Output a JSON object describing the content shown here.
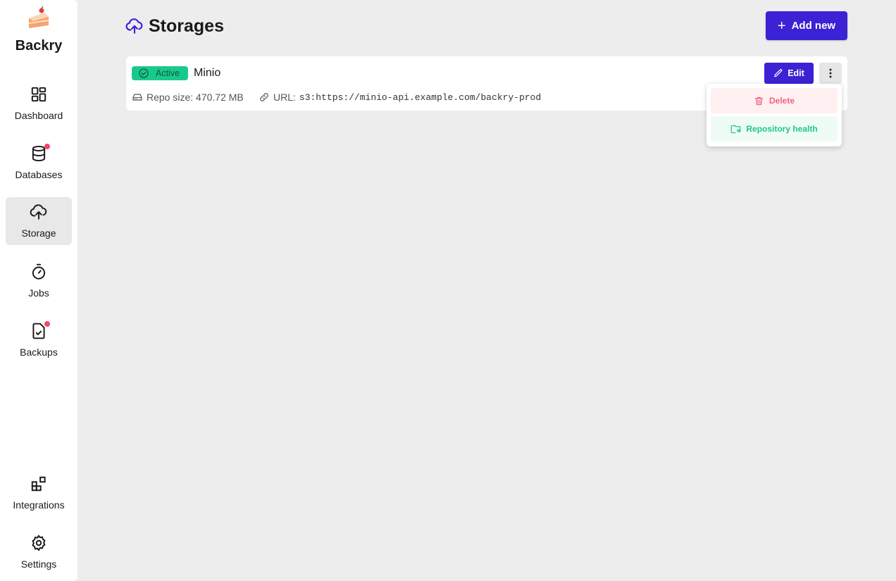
{
  "app": {
    "name": "Backry"
  },
  "sidebar": {
    "items": [
      {
        "label": "Dashboard",
        "icon": "dashboard-icon",
        "active": false,
        "notification": false
      },
      {
        "label": "Databases",
        "icon": "database-icon",
        "active": false,
        "notification": true
      },
      {
        "label": "Storage",
        "icon": "cloud-upload-icon",
        "active": true,
        "notification": false
      },
      {
        "label": "Jobs",
        "icon": "stopwatch-icon",
        "active": false,
        "notification": false
      },
      {
        "label": "Backups",
        "icon": "file-check-icon",
        "active": false,
        "notification": true
      }
    ],
    "bottom_items": [
      {
        "label": "Integrations",
        "icon": "integrations-icon"
      },
      {
        "label": "Settings",
        "icon": "gear-icon"
      }
    ]
  },
  "header": {
    "title": "Storages",
    "icon": "cloud-upload-icon"
  },
  "add_button": {
    "label": "Add new"
  },
  "storages": [
    {
      "status": "Active",
      "name": "Minio",
      "repo_size_label": "Repo size: 470.72 MB",
      "url_label": "URL:",
      "url": "s3:https://minio-api.example.com/backry-prod",
      "edit_label": "Edit"
    }
  ],
  "dropdown": {
    "delete_label": "Delete",
    "health_label": "Repository health"
  },
  "colors": {
    "accent": "#3b22d4",
    "active_badge": "#19c98b",
    "notification": "#f0476a",
    "danger": "#f0627c",
    "success": "#1cc98a"
  }
}
